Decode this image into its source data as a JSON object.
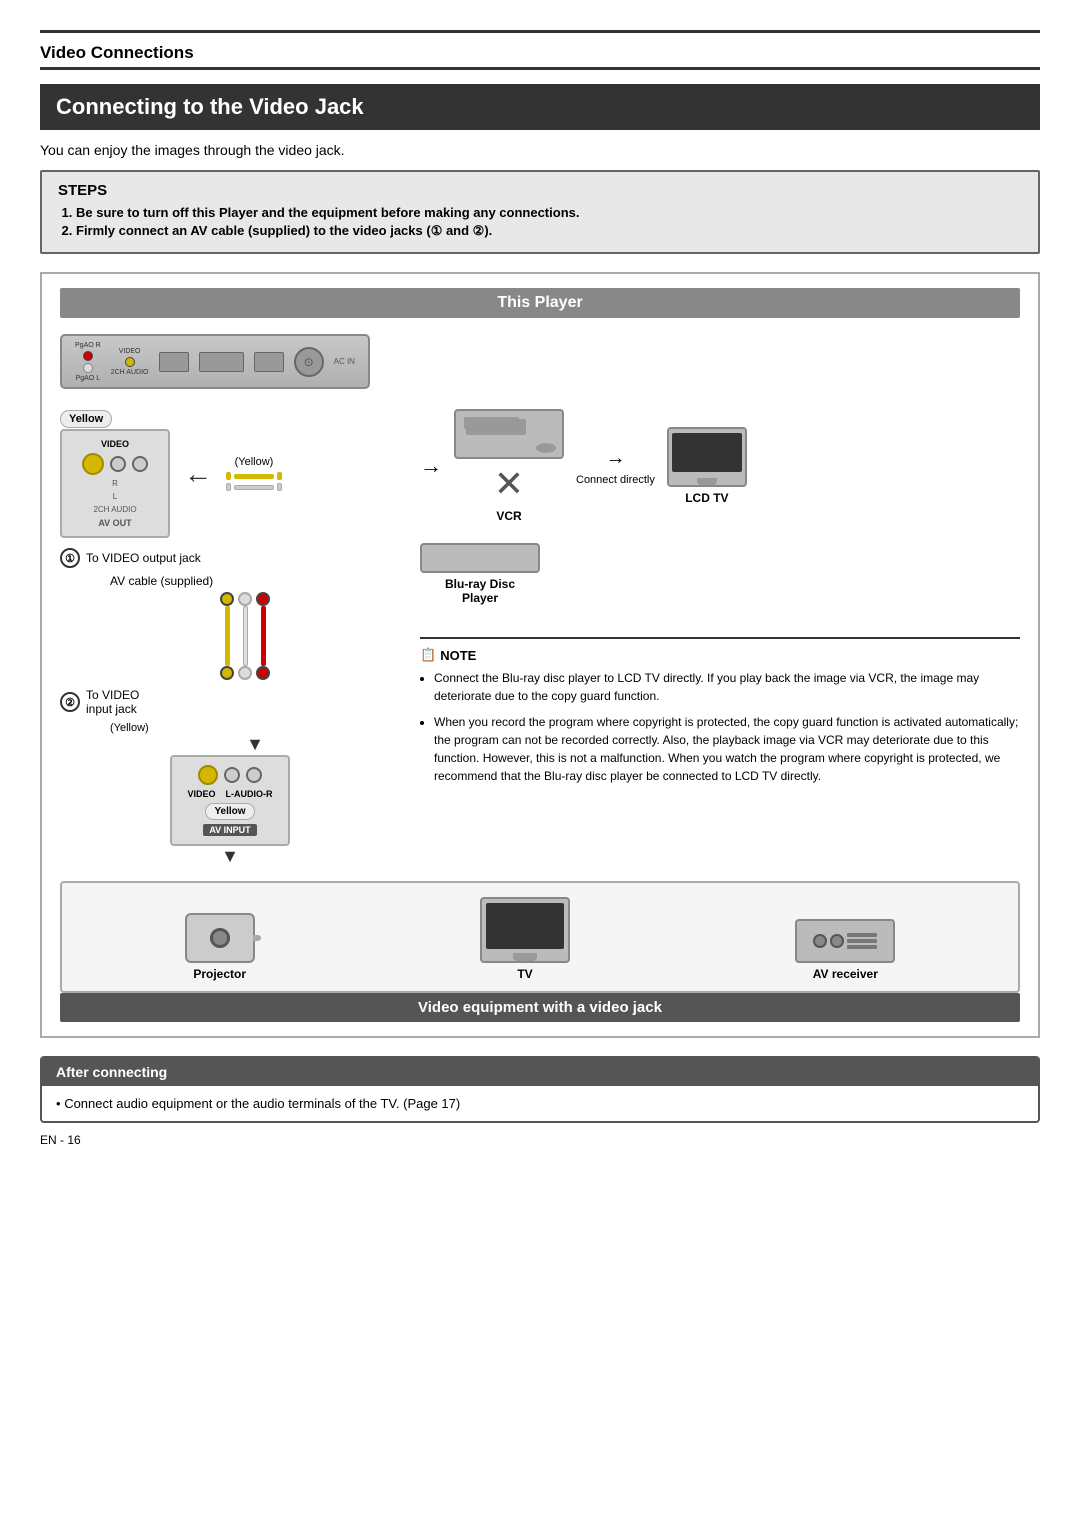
{
  "page": {
    "section_title": "Video Connections",
    "main_heading": "Connecting to the Video Jack",
    "intro_text": "You can enjoy the images through the video jack.",
    "steps_title": "STEPS",
    "step1": "Be sure to turn off this Player and the equipment before making any connections.",
    "step2": "Firmly connect an AV cable (supplied) to the video jacks (① and ②).",
    "this_player_label": "This Player",
    "step1_label": "To VIDEO output jack",
    "step2_label": "To VIDEO\ninput jack",
    "yellow_label": "Yellow",
    "yellow_label2": "(Yellow)",
    "yellow_label3": "(Yellow)",
    "av_cable_label": "AV cable (supplied)",
    "av_out_label": "AV OUT",
    "av_input_label": "AV INPUT",
    "video_label": "VIDEO",
    "audio_label": "L-AUDIO-R",
    "vcr_label": "VCR",
    "blu_ray_label": "Blu-ray Disc\nPlayer",
    "lcd_tv_label": "LCD TV",
    "connect_directly": "Connect directly",
    "note_title": "NOTE",
    "note1": "Connect the Blu-ray disc player to LCD TV directly. If you play back the image via VCR, the image may deteriorate due to the copy guard function.",
    "note2": "When you record the program where copyright is protected, the copy guard function is activated automatically; the program can not be recorded correctly. Also, the playback image via VCR may deteriorate due to this function. However, this is not a malfunction. When you watch the program where copyright is protected, we recommend that the Blu-ray disc player be connected to LCD TV directly.",
    "projector_label": "Projector",
    "tv_label": "TV",
    "av_receiver_label": "AV receiver",
    "video_jack_banner": "Video equipment with a video jack",
    "after_connecting_header": "After connecting",
    "after_connecting_text": "Connect audio equipment or the audio terminals of the TV. (Page 17)",
    "page_number": "EN - 16"
  }
}
